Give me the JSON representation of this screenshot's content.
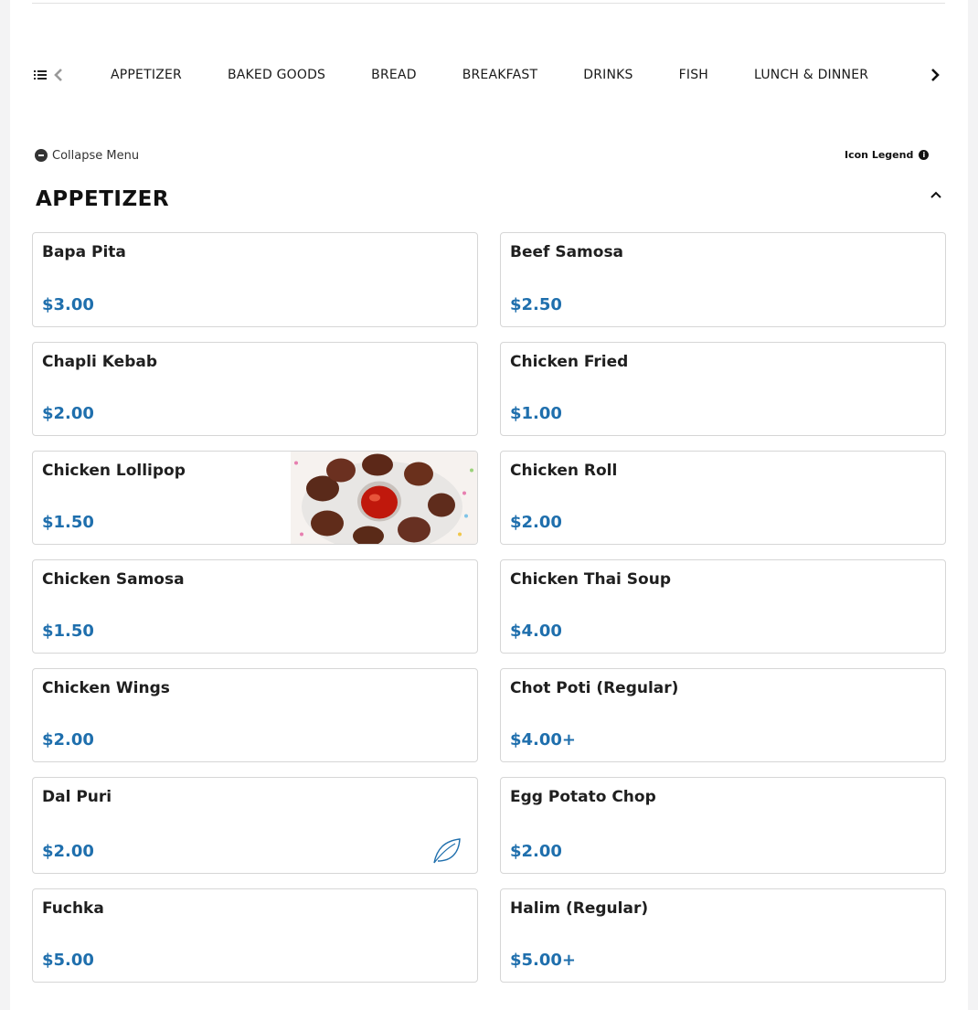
{
  "nav": {
    "list_icon": "list-icon",
    "prev_icon": "chevron-left-icon",
    "next_icon": "chevron-right-icon",
    "categories": [
      "APPETIZER",
      "BAKED GOODS",
      "BREAD",
      "BREAKFAST",
      "DRINKS",
      "FISH",
      "LUNCH & DINNER"
    ]
  },
  "controls": {
    "collapse_label": "Collapse Menu",
    "legend_label": "Icon Legend",
    "legend_icon": "info-icon"
  },
  "section": {
    "title": "APPETIZER",
    "toggle_icon": "chevron-up-icon"
  },
  "items": [
    {
      "name": "Bapa Pita",
      "price": "$3.00"
    },
    {
      "name": "Beef Samosa",
      "price": "$2.50"
    },
    {
      "name": "Chapli Kebab",
      "price": "$2.00"
    },
    {
      "name": "Chicken Fried",
      "price": "$1.00"
    },
    {
      "name": "Chicken Lollipop",
      "price": "$1.50",
      "image": "chicken-lollipop-photo"
    },
    {
      "name": "Chicken Roll",
      "price": "$2.00"
    },
    {
      "name": "Chicken Samosa",
      "price": "$1.50"
    },
    {
      "name": "Chicken Thai Soup",
      "price": "$4.00"
    },
    {
      "name": "Chicken Wings",
      "price": "$2.00"
    },
    {
      "name": "Chot Poti (Regular)",
      "price": "$4.00+"
    },
    {
      "name": "Dal Puri",
      "price": "$2.00",
      "badge": "vegetarian-leaf-icon"
    },
    {
      "name": "Egg Potato Chop",
      "price": "$2.00"
    },
    {
      "name": "Fuchka",
      "price": "$5.00"
    },
    {
      "name": "Halim (Regular)",
      "price": "$5.00+"
    }
  ],
  "colors": {
    "price": "#1f6fad",
    "border": "#d6d6d6",
    "background": "#f3f3f4"
  }
}
